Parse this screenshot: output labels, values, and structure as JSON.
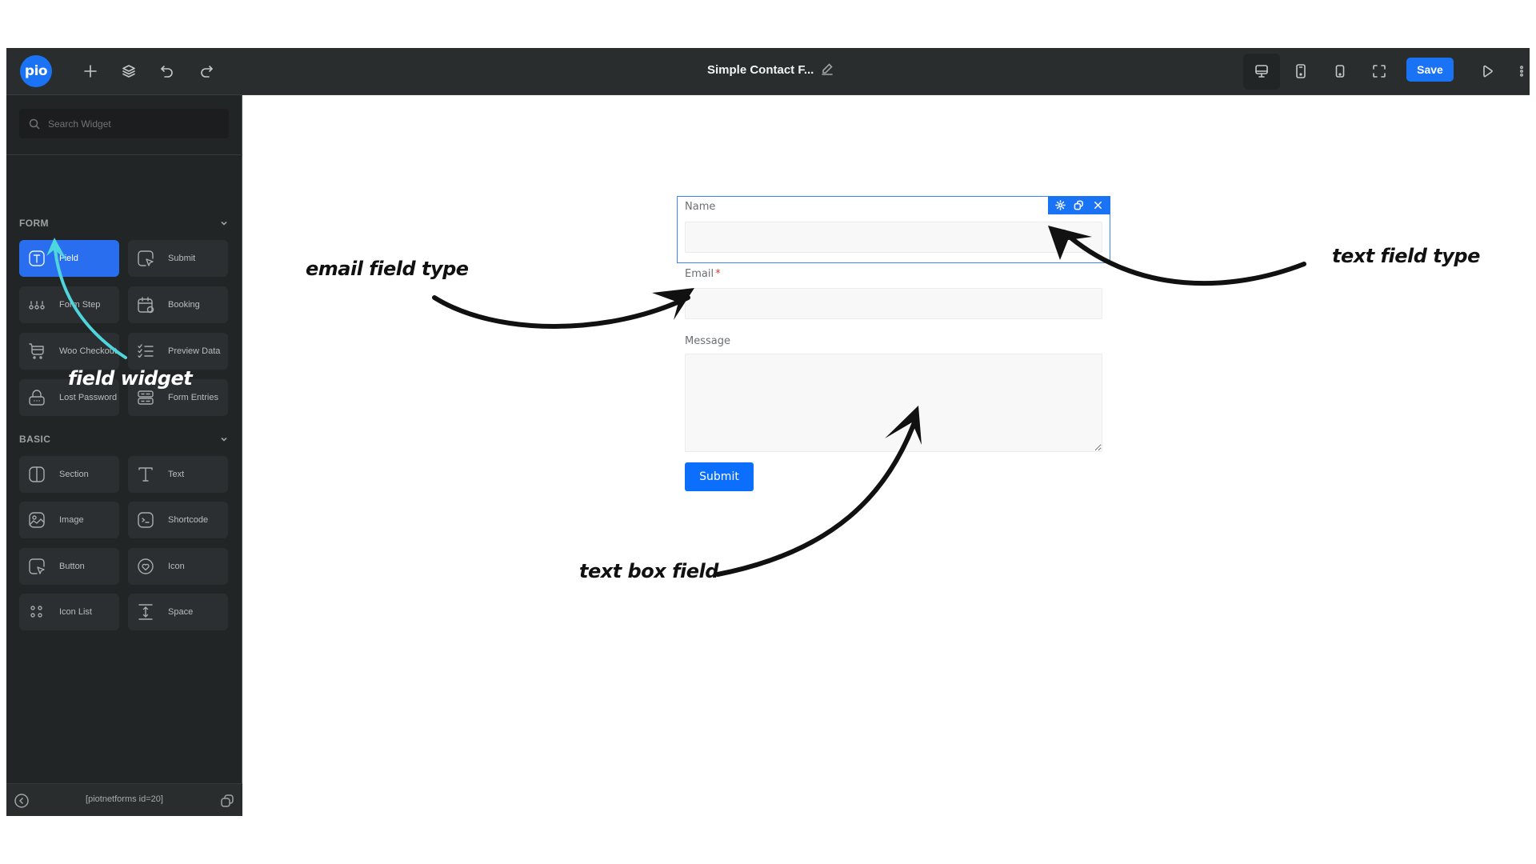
{
  "topbar": {
    "logo_text": "pio",
    "title": "Simple Contact F...",
    "save_label": "Save",
    "icons": [
      "plus-icon",
      "layers-icon",
      "undo-icon",
      "redo-icon",
      "edit-icon",
      "desktop-icon",
      "tablet-icon",
      "mobile-icon",
      "fullscreen-icon",
      "preview-play-icon",
      "more-vertical-icon"
    ],
    "active_device": "desktop"
  },
  "sidebar": {
    "search_placeholder": "Search Widget",
    "sections": [
      {
        "title": "FORM",
        "widgets": [
          {
            "label": "Field",
            "icon": "text-field-icon",
            "active": true
          },
          {
            "label": "Submit",
            "icon": "submit-icon"
          },
          {
            "label": "Form Step",
            "icon": "steps-icon"
          },
          {
            "label": "Booking",
            "icon": "calendar-icon"
          },
          {
            "label": "Woo Checkout",
            "icon": "cart-icon"
          },
          {
            "label": "Preview Data",
            "icon": "checklist-icon"
          },
          {
            "label": "Lost Password",
            "icon": "lock-icon"
          },
          {
            "label": "Form Entries",
            "icon": "entries-icon"
          }
        ]
      },
      {
        "title": "BASIC",
        "widgets": [
          {
            "label": "Section",
            "icon": "section-icon"
          },
          {
            "label": "Text",
            "icon": "text-icon"
          },
          {
            "label": "Image",
            "icon": "image-icon"
          },
          {
            "label": "Shortcode",
            "icon": "shortcode-icon"
          },
          {
            "label": "Button",
            "icon": "button-icon"
          },
          {
            "label": "Icon",
            "icon": "heart-icon"
          },
          {
            "label": "Icon List",
            "icon": "icon-list-icon"
          },
          {
            "label": "Space",
            "icon": "space-icon"
          }
        ]
      }
    ],
    "footer_shortcode": "[piotnetforms id=20]"
  },
  "form": {
    "fields": [
      {
        "label": "Name",
        "type": "text",
        "value": "",
        "required": false,
        "selected": true
      },
      {
        "label": "Email",
        "type": "email",
        "value": "",
        "required": true,
        "required_mark": "*"
      },
      {
        "label": "Message",
        "type": "textarea",
        "value": "",
        "required": false
      }
    ],
    "submit_label": "Submit",
    "accent_color": "#0b6efd"
  },
  "annotations": {
    "email": "email field type",
    "text": "text field type",
    "textbox": "text box field",
    "widget": "field widget"
  }
}
